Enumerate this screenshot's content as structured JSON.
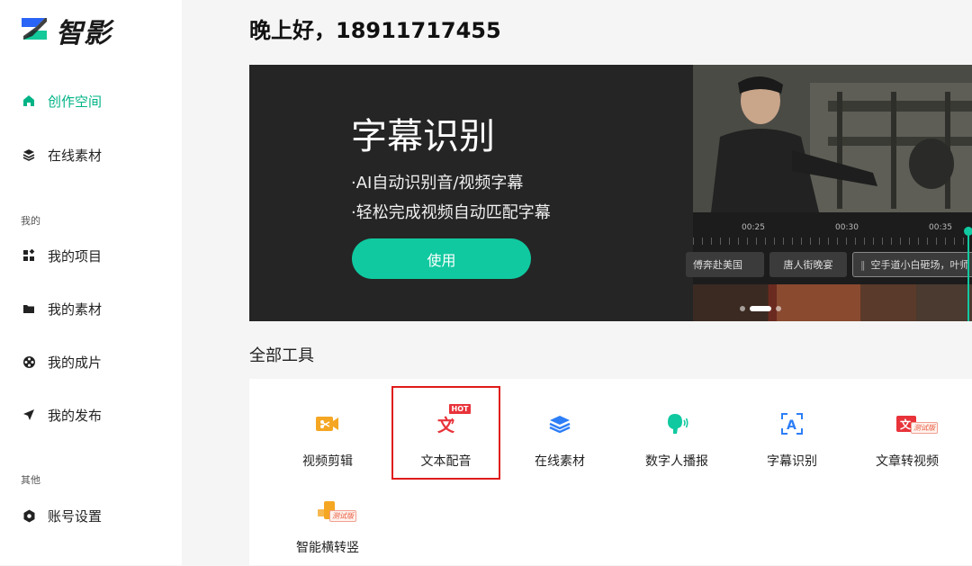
{
  "app": {
    "name": "智影",
    "brand_color": "#00b386",
    "accent_color": "#10c9a0"
  },
  "sidebar": {
    "main_items": [
      {
        "label": "创作空间",
        "icon": "home-icon",
        "active": true
      },
      {
        "label": "在线素材",
        "icon": "layers-icon",
        "active": false
      }
    ],
    "mine_section": {
      "label": "我的",
      "items": [
        {
          "label": "我的项目",
          "icon": "grid-icon"
        },
        {
          "label": "我的素材",
          "icon": "folder-icon"
        },
        {
          "label": "我的成片",
          "icon": "film-reel-icon"
        },
        {
          "label": "我的发布",
          "icon": "send-icon"
        }
      ]
    },
    "other_section": {
      "label": "其他",
      "items": [
        {
          "label": "账号设置",
          "icon": "hexagon-settings-icon"
        }
      ]
    }
  },
  "header": {
    "greeting": "晚上好，18911717455"
  },
  "banner": {
    "title": "字幕识别",
    "lines": [
      "·AI自动识别音/视频字幕",
      "·轻松完成视频自动匹配字幕"
    ],
    "button_label": "使用",
    "timeline": {
      "times": [
        "00:25",
        "00:30",
        "00:35"
      ],
      "clips": [
        "傅奔赴美国",
        "唐人街晚宴",
        "空手道小白砸场，叶师"
      ]
    },
    "carousel": {
      "count": 3,
      "active_index": 1
    }
  },
  "tools": {
    "title": "全部工具",
    "items": [
      {
        "label": "视频剪辑",
        "icon": "video-edit-icon",
        "badge": ""
      },
      {
        "label": "文本配音",
        "icon": "text-to-speech-icon",
        "badge": "HOT"
      },
      {
        "label": "在线素材",
        "icon": "layers-icon",
        "badge": ""
      },
      {
        "label": "数字人播报",
        "icon": "digital-human-icon",
        "badge": ""
      },
      {
        "label": "字幕识别",
        "icon": "subtitle-scan-icon",
        "badge": ""
      },
      {
        "label": "文章转视频",
        "icon": "article-to-video-icon",
        "badge": "测试版"
      },
      {
        "label": "智能横转竖",
        "icon": "landscape-to-portrait-icon",
        "badge": "测试版"
      }
    ]
  }
}
